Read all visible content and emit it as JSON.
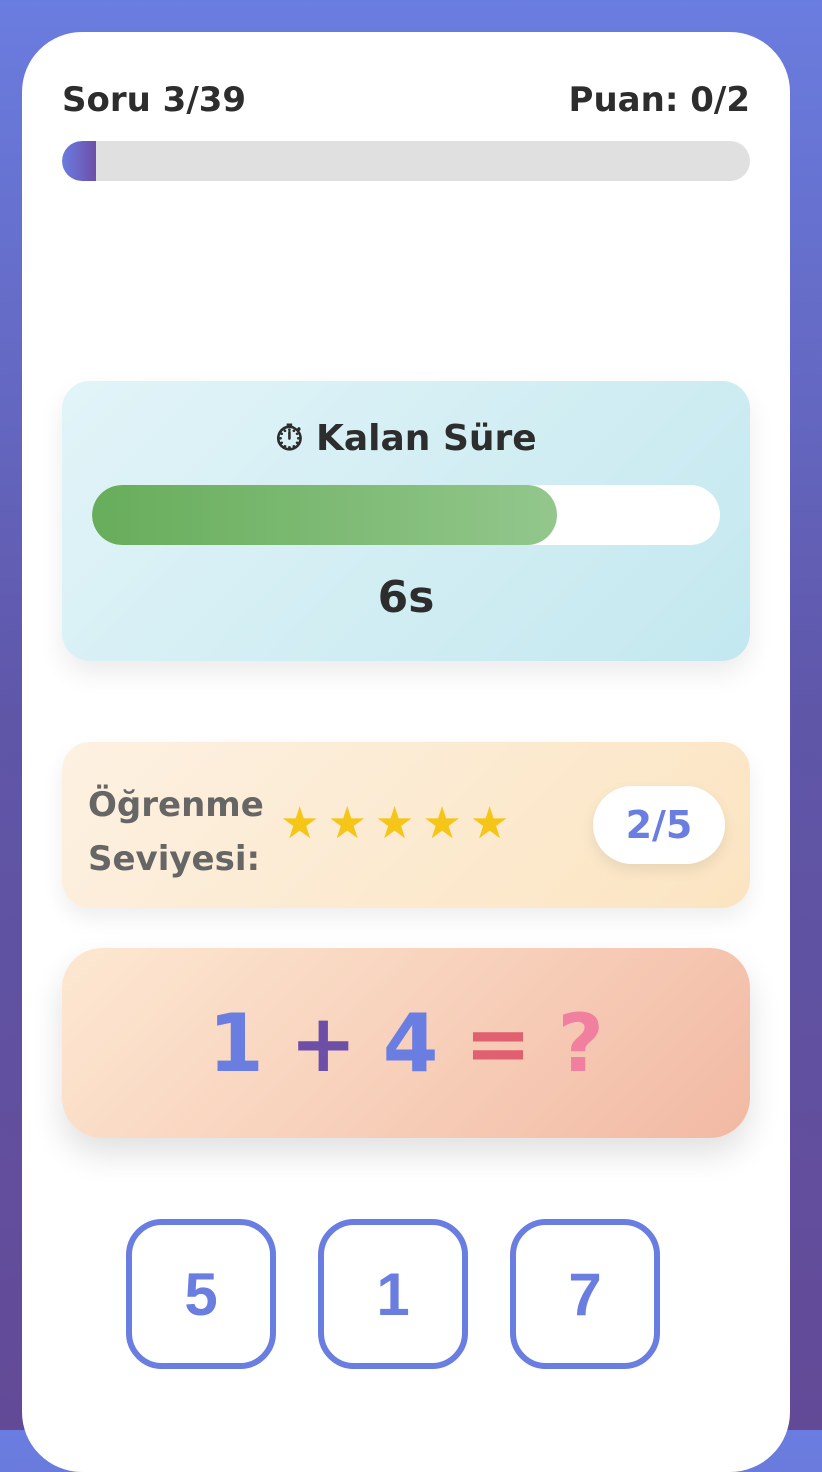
{
  "header": {
    "question": "Soru 3/39",
    "score": "Puan: 0/2",
    "progress_fraction": 0.05
  },
  "timer": {
    "icon": "stopwatch-icon",
    "title": "Kalan Süre",
    "value": "6s",
    "remaining_fraction": 0.74
  },
  "level": {
    "label": "Öğrenme Seviyesi:",
    "stars": 5,
    "badge": "2/5"
  },
  "equation": {
    "a": "1",
    "op": "+",
    "b": "4",
    "eq": "=",
    "unknown": "?"
  },
  "answers": [
    "5",
    "1",
    "7"
  ],
  "colors": {
    "accent": "#6a7de0",
    "purple": "#6d4fa8",
    "green": "#67ad5b",
    "star": "#f5c518"
  }
}
